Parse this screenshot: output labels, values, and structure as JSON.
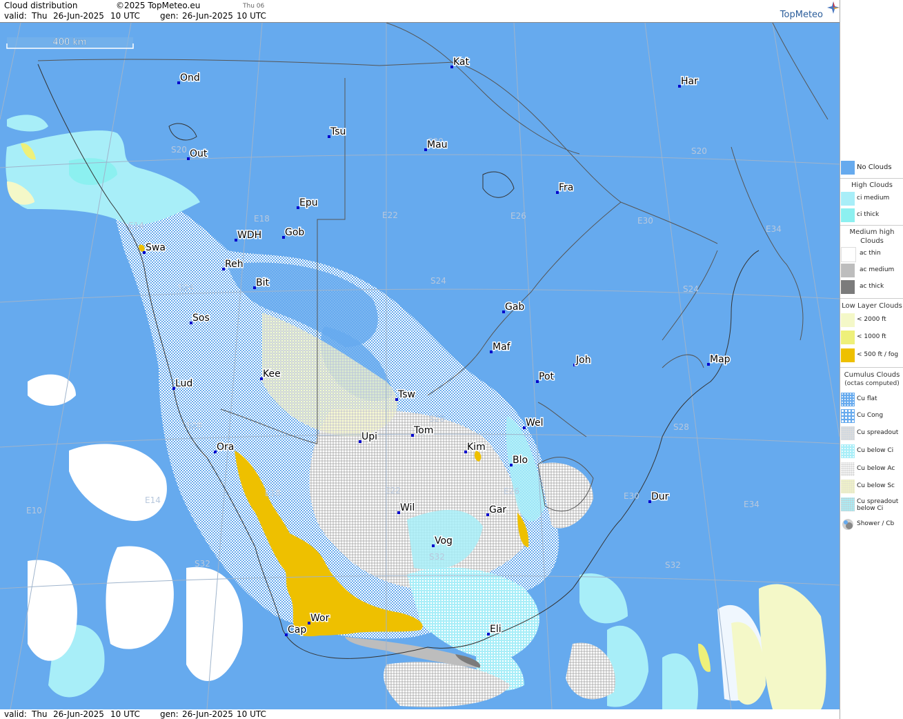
{
  "header": {
    "title": "Cloud distribution",
    "copyright": "©2025 TopMeteo.eu",
    "day_code": "Thu 06",
    "valid_label": "valid:",
    "valid_day": "Thu",
    "valid_date": "26-Jun-2025",
    "valid_time": "10 UTC",
    "gen_label": "gen:",
    "gen_date": "26-Jun-2025",
    "gen_time": "10 UTC",
    "brand": "TopMeteo"
  },
  "scale": {
    "label": "400 km"
  },
  "footer": {
    "valid_label": "valid:",
    "valid_day": "Thu",
    "valid_date": "26-Jun-2025",
    "valid_time": "10 UTC",
    "gen_label": "gen:",
    "gen_date": "26-Jun-2025",
    "gen_time": "10 UTC"
  },
  "colors": {
    "no_clouds": "#66aaee",
    "ci_medium": "#a8eef8",
    "ci_thick": "#8cf0f0",
    "ac_thin": "#ffffff",
    "ac_medium": "#bdbdbd",
    "ac_thick": "#7b7b7b",
    "low_2000": "#f4f8c8",
    "low_1000": "#eef07a",
    "low_500": "#eec000",
    "border": "#555555",
    "grid": "#aab8cc"
  },
  "legend": {
    "no_clouds": "No Clouds",
    "high_title": "High Clouds",
    "ci_medium": "ci medium",
    "ci_thick": "ci thick",
    "medium_title": "Medium high Clouds",
    "ac_thin": "ac thin",
    "ac_medium": "ac medium",
    "ac_thick": "ac thick",
    "low_title": "Low Layer Clouds",
    "low_2000": "< 2000 ft",
    "low_1000": "< 1000 ft",
    "low_500": "< 500 ft / fog",
    "cu_title": "Cumulus Clouds",
    "cu_sub": "(octas computed)",
    "cu_flat": "Cu flat",
    "cu_cong": "Cu Cong",
    "cu_spread": "Cu spreadout",
    "cu_ci": "Cu below Ci",
    "cu_ac": "Cu below Ac",
    "cu_sc": "Cu below Sc",
    "cu_spread_ci": "Cu spreadout below Ci",
    "shower": "Shower / Cb"
  },
  "cities": [
    {
      "name": "Kat"
    },
    {
      "name": "Ond"
    },
    {
      "name": "Har"
    },
    {
      "name": "Tsu"
    },
    {
      "name": "Mau"
    },
    {
      "name": "Out"
    },
    {
      "name": "Fra"
    },
    {
      "name": "Epu"
    },
    {
      "name": "Gob"
    },
    {
      "name": "WDH"
    },
    {
      "name": "Swa"
    },
    {
      "name": "Reh"
    },
    {
      "name": "Bit"
    },
    {
      "name": "Gab"
    },
    {
      "name": "Sos"
    },
    {
      "name": "Maf"
    },
    {
      "name": "Joh"
    },
    {
      "name": "Map"
    },
    {
      "name": "Lud"
    },
    {
      "name": "Kee"
    },
    {
      "name": "Pot"
    },
    {
      "name": "Tsw"
    },
    {
      "name": "Wel"
    },
    {
      "name": "Ora"
    },
    {
      "name": "Upi"
    },
    {
      "name": "Tom"
    },
    {
      "name": "Kim"
    },
    {
      "name": "Blo"
    },
    {
      "name": "Dur"
    },
    {
      "name": "Wil"
    },
    {
      "name": "Gar"
    },
    {
      "name": "Vog"
    },
    {
      "name": "Wor"
    },
    {
      "name": "Cap"
    },
    {
      "name": "Eli"
    }
  ],
  "grid_labels": [
    "S20",
    "S20",
    "S20",
    "S24",
    "S24",
    "S24",
    "S28",
    "S28",
    "S28",
    "S32",
    "S32",
    "S32",
    "E14",
    "E18",
    "E22",
    "E26",
    "E30",
    "E34",
    "E10",
    "E14",
    "E18",
    "E22",
    "E26",
    "E30",
    "E34"
  ]
}
